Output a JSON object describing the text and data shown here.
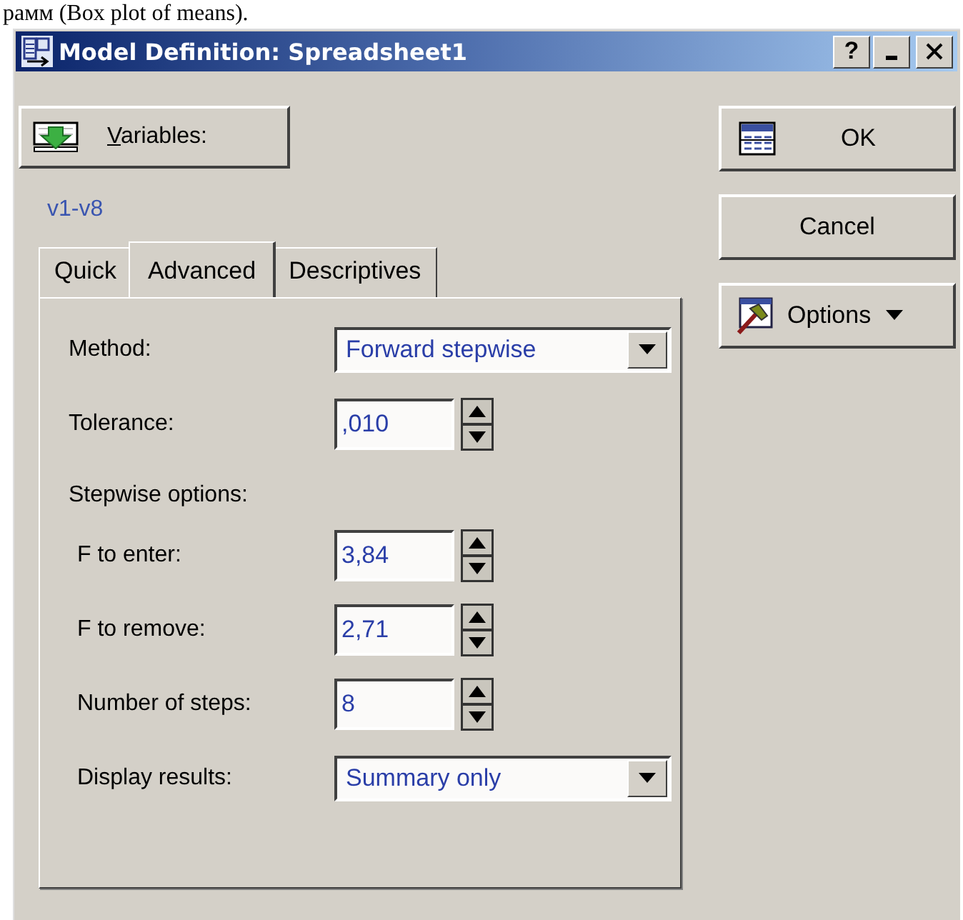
{
  "page_caption": "рамм (Box plot of means).",
  "window": {
    "title": "Model Definition: Spreadsheet1",
    "title_buttons": [
      {
        "kind": "help",
        "label": "?"
      },
      {
        "kind": "minimize"
      },
      {
        "kind": "close"
      }
    ]
  },
  "variables_button": {
    "label": "Variables:"
  },
  "variables_value": "v1-v8",
  "side_buttons": [
    {
      "kind": "ok",
      "label": "OK"
    },
    {
      "kind": "plain",
      "label": "Cancel"
    },
    {
      "kind": "menu",
      "label": "Options"
    }
  ],
  "tabs": [
    {
      "label": "Quick",
      "selected": false
    },
    {
      "label": "Advanced",
      "selected": true
    },
    {
      "label": "Descriptives",
      "selected": false
    }
  ],
  "fields": [
    {
      "kind": "combo",
      "label": "Method:",
      "value": "Forward stepwise"
    },
    {
      "kind": "spin",
      "label": "Tolerance:",
      "value": ",010"
    },
    {
      "kind": "heading",
      "label": "Stepwise options:",
      "children": [
        {
          "kind": "spin",
          "label": "F to enter:",
          "value": "3,84"
        },
        {
          "kind": "spin",
          "label": "F to remove:",
          "value": "2,71"
        },
        {
          "kind": "spin",
          "label": "Number of steps:",
          "value": "8"
        },
        {
          "kind": "combo",
          "label": "Display results:",
          "value": "Summary only"
        }
      ]
    }
  ]
}
